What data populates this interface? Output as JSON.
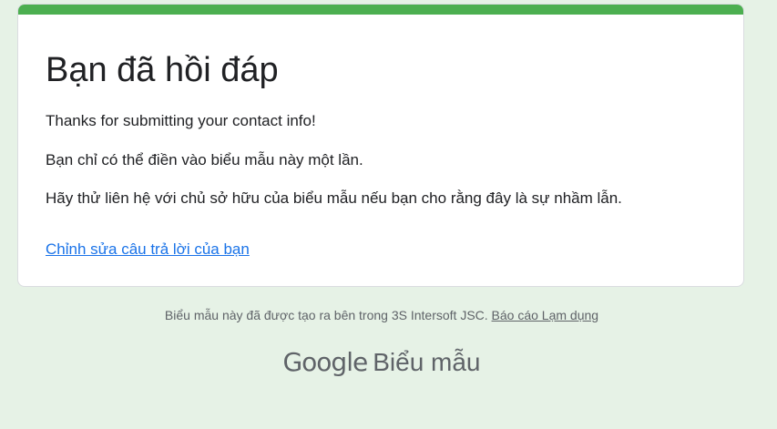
{
  "card": {
    "title": "Bạn đã hồi đáp",
    "messages": [
      "Thanks for submitting your contact info!",
      "Bạn chỉ có thể điền vào biểu mẫu này một lần.",
      "Hãy thử liên hệ với chủ sở hữu của biểu mẫu nếu bạn cho rằng đây là sự nhầm lẫn."
    ],
    "edit_link": "Chỉnh sửa câu trả lời của bạn"
  },
  "footer": {
    "note": "Biểu mẫu này đã được tạo ra bên trong 3S Intersoft JSC.",
    "report_link": "Báo cáo Lạm dụng",
    "brand_google": "Google",
    "brand_product": "Biểu mẫu"
  },
  "colors": {
    "accent": "#4caf50",
    "background": "#e6f2e6",
    "link": "#1a73e8"
  }
}
